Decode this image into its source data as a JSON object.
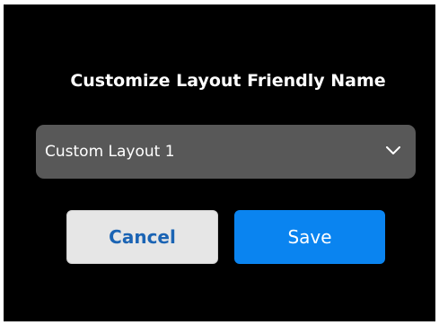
{
  "dialog": {
    "title": "Customize Layout Friendly Name",
    "dropdown": {
      "selected_value": "Custom Layout 1",
      "icon": "chevron-down-icon"
    },
    "buttons": {
      "cancel_label": "Cancel",
      "save_label": "Save"
    }
  },
  "colors": {
    "background": "#000000",
    "dropdown_bg": "#585858",
    "cancel_bg": "#e6e6e6",
    "cancel_text": "#1b64b4",
    "save_bg": "#0a84f0"
  }
}
